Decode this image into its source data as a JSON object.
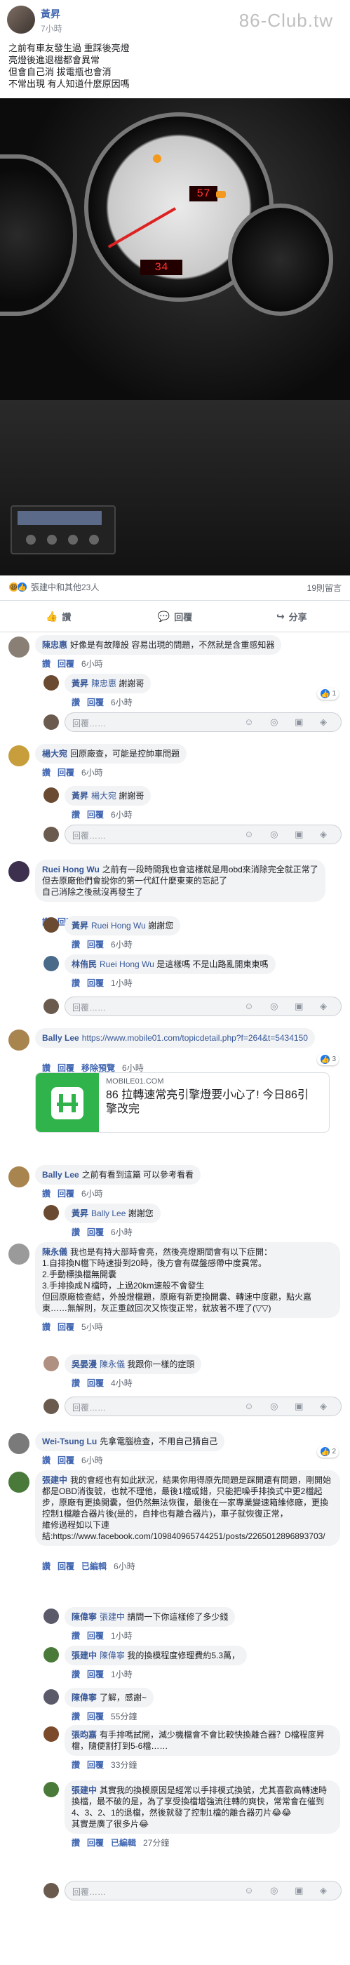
{
  "post": {
    "author": "黃昇",
    "time": "7小時",
    "lines": [
      "之前有車友發生過 重踩後亮燈",
      "亮燈後進退檔都會異常",
      "但會自己消 拔電瓶也會消",
      "不常出現 有人知道什麼原因嗎"
    ],
    "watermark": "86-Club.tw",
    "digital_display": "57",
    "digital_display2": "34"
  },
  "reactions": {
    "names": "張建中和其他23人",
    "comments": "19則留言"
  },
  "actions": {
    "like": "讚",
    "comment": "回覆",
    "share": "分享"
  },
  "comments": [
    {
      "name": "陳忠惠",
      "text": "好像是有故障設 容易出現的問題，不然就是含重感知器",
      "actions": [
        "讚",
        "回覆"
      ],
      "time": "6小時"
    },
    {
      "name": "黃昇",
      "tag": "陳忠惠",
      "text": "謝謝哥",
      "actions": [
        "讚",
        "回覆"
      ],
      "time": "6小時"
    },
    {
      "placeholder": "回覆……"
    },
    {
      "name": "楊大宛",
      "text": "回原廠查，可能是控帥車問題",
      "actions": [
        "讚",
        "回覆"
      ],
      "time": "6小時"
    },
    {
      "name": "黃昇",
      "tag": "楊大宛",
      "text": "謝謝哥",
      "actions": [
        "讚",
        "回覆"
      ],
      "time": "6小時"
    },
    {
      "placeholder": "回覆……"
    },
    {
      "name": "Ruei Hong Wu",
      "text": "之前有一段時間我也會這樣就是用obd來消除完全就正常了",
      "text2": "但去原廠他們會說你的第一代紅什麼東東的忘記了",
      "text3": "自己消除之後就沒再發生了",
      "actions": [
        "讚",
        "回覆"
      ],
      "time": "6小時"
    },
    {
      "name": "黃昇",
      "tag": "Ruei Hong Wu",
      "text": "謝謝您",
      "actions": [
        "讚",
        "回覆"
      ],
      "time": "6小時"
    },
    {
      "name": "林侑民",
      "tag": "Ruei Hong Wu",
      "text": "是這樣嗎 不是山路亂開東東嗎",
      "actions": [
        "讚",
        "回覆"
      ],
      "time": "1小時"
    },
    {
      "placeholder": "回覆……"
    },
    {
      "name": "Bally Lee",
      "text": "https://www.mobile01.com/topicdetail.php?f=264&t=5434150",
      "actions": [
        "讚",
        "回覆",
        "移除預覽"
      ],
      "time": "6小時"
    },
    {
      "link_domain": "MOBILE01.COM",
      "link_title": "86 拉轉速常亮引擎燈要小心了! 今日86引擎改完"
    },
    {
      "name": "Bally Lee",
      "text": "之前有看到這篇 可以參考看看",
      "actions": [
        "讚",
        "回覆"
      ],
      "time": "6小時"
    },
    {
      "name": "黃昇",
      "tag": "Bally Lee",
      "text": "謝謝您",
      "actions": [
        "讚",
        "回覆"
      ],
      "time": "6小時"
    },
    {
      "name": "陳永儀",
      "text": "我也是有持大部時會亮，然後亮燈期間會有以下症開：",
      "text2": "1.自排換N檔下時速掛到20時，後方會有碟盤感帶中度異常。",
      "text3": "2.手動標換檔無開囊",
      "text4": "3.手排換成Ｎ檔時，上過20km速般不會發生",
      "text5": "但回原廠檢查結，外設燈檔題，原廠有新更換開囊、轉速中度觀，點火嘉東……無解則，灰正重啟回次又恢復正常，就放著不理了(▽▽)",
      "actions": [
        "讚",
        "回覆"
      ],
      "time": "5小時"
    },
    {
      "name": "吳晏漫",
      "tag": "陳永儀",
      "text": "我跟你一樣的症頭",
      "actions": [
        "讚",
        "回覆"
      ],
      "time": "4小時"
    },
    {
      "placeholder": "回覆……"
    },
    {
      "name": "Wei-Tsung Lu",
      "text": "先拿電腦檢查，不用自己猜自己",
      "actions": [
        "讚",
        "回覆"
      ],
      "time": "6小時"
    },
    {
      "name": "張建中",
      "text": "我的會經也有如此狀況，結果你用得原先問題是踩開還有問題，剛開始都是OBD消復號，也就不理他，最後1檔或錯，只能把噪手排換式中更2檔起步，原廠有更換開囊，但仍然無法恢復，最後在一家專業變速箱維修廠，更換控制1檔離合器片後(是的，自排也有離合器片)，車子就恢復正常，",
      "text2": "維修過程如以下連",
      "text3": "結:https://www.facebook.com/109840965744251/posts/2265012896893703/",
      "actions": [
        "讚",
        "回覆",
        "已編輯"
      ],
      "time": "6小時"
    },
    {
      "name": "陳偉寧",
      "tag": "張建中",
      "text": "請問一下你這樣修了多少錢",
      "actions": [
        "讚",
        "回覆"
      ],
      "time": "1小時"
    },
    {
      "name": "張建中",
      "tag": "陳偉寧",
      "text": "我的換模程度修理費約5.3萬，",
      "actions": [
        "讚",
        "回覆"
      ],
      "time": "1小時"
    },
    {
      "name": "陳偉寧",
      "text": "了解，感謝~",
      "actions": [
        "讚",
        "回覆"
      ],
      "time": "55分鐘"
    },
    {
      "name": "張昀嘉",
      "text": "有手排嗎試開，減少機檔會不會比較快換離合器？D檔程度昇檔，隨便割打到5-6檔……",
      "actions": [
        "讚",
        "回覆"
      ],
      "time": "33分鐘"
    },
    {
      "name": "張建中",
      "text": "其實我的換模原因是經常以手排模式換號，尤其喜歡高轉速時換檔，最不破的是，為了享受換檔增強流往轉的爽快，常常會在催到4、3、2、1的退檔，然後就發了控制1檔的離合器刃片😂😂",
      "text2": "其實是廣了很多片😂",
      "actions": [
        "讚",
        "回覆",
        "已編輯"
      ],
      "time": "27分鐘"
    },
    {
      "placeholder": "回覆……"
    }
  ],
  "reaction_counts": {
    "c1": "1",
    "c10": "3",
    "c17": "2"
  }
}
